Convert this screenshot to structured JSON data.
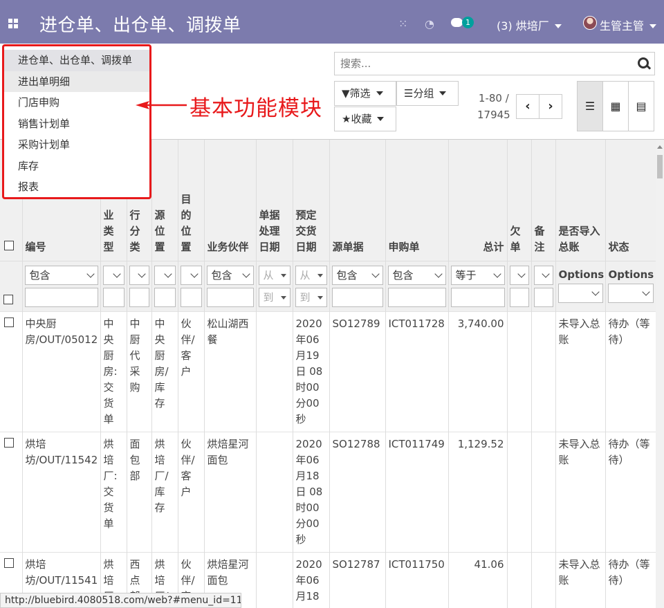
{
  "navbar": {
    "title": "进仓单、出仓单、调拨单",
    "badge_count": "1",
    "company": "(3) 烘培厂",
    "user": "生管主管",
    "icons": [
      "apps-icon",
      "spinner-icon",
      "clock-icon",
      "chat-icon"
    ]
  },
  "menu": {
    "items": [
      "进仓单、出仓单、调拨单",
      "进出单明细",
      "门店申购",
      "销售计划单",
      "采购计划单",
      "库存",
      "报表"
    ]
  },
  "annotation": {
    "text": "基本功能模块",
    "color": "#e8191b"
  },
  "search": {
    "placeholder": "搜索..."
  },
  "buttons": {
    "filter": "筛选",
    "group": "分组",
    "favorite": "收藏"
  },
  "pager": {
    "range": "1-80 /",
    "total": "17945"
  },
  "table": {
    "headers": {
      "number": "编号",
      "type": "业类型",
      "category": "行分类",
      "source_loc": "源位置",
      "dest_loc": "目的位置",
      "partner": "业务伙伴",
      "process_date": "单据处理日期",
      "delivery_date": "预定交货日期",
      "source_doc": "源单据",
      "purchase": "申购单",
      "total": "总计",
      "backorder": "欠单",
      "note": "备注",
      "imported": "是否导入总账",
      "status": "状态"
    },
    "filters": {
      "contains": "包含",
      "equals": "等于",
      "from": "从",
      "to": "到",
      "options": "Options"
    },
    "rows": [
      {
        "number": "中央厨房/OUT/05012",
        "type": "中央厨房:交货单",
        "category": "中厨代采购",
        "source_loc": "中央厨房/库存",
        "dest_loc": "伙伴/客户",
        "partner": "松山湖西餐",
        "delivery_date": "2020年06月19日 08时00分00秒",
        "source_doc": "SO12789",
        "purchase": "ICT011728",
        "total": "3,740.00",
        "imported": "未导入总账",
        "status": "待办（等待）"
      },
      {
        "number": "烘培坊/OUT/11542",
        "type": "烘培厂:交货单",
        "category": "面包部",
        "source_loc": "烘培厂/库存",
        "dest_loc": "伙伴/客户",
        "partner": "烘焙星河面包",
        "delivery_date": "2020年06月18日 08时00分00秒",
        "source_doc": "SO12788",
        "purchase": "ICT011749",
        "total": "1,129.52",
        "imported": "未导入总账",
        "status": "待办（等待）"
      },
      {
        "number": "烘培坊/OUT/11541",
        "type": "烘培厂:",
        "category": "西点部",
        "source_loc": "烘培厂/",
        "dest_loc": "伙伴/客",
        "partner": "烘焙星河面包",
        "delivery_date": "2020年06月18",
        "source_doc": "SO12787",
        "purchase": "ICT011750",
        "total": "41.06",
        "imported": "未导入总账",
        "status": "待办（等待）"
      }
    ]
  },
  "statusbar": {
    "url": "http://bluebird.4080518.com/web?#menu_id=1119"
  }
}
